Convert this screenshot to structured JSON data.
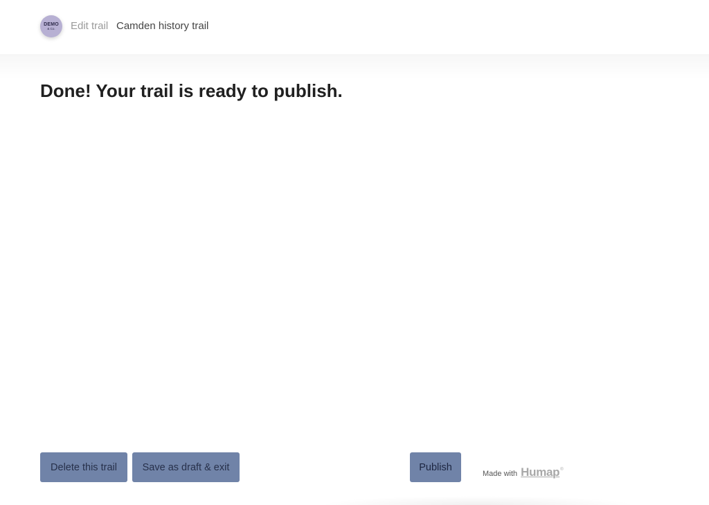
{
  "header": {
    "avatar": {
      "line1": "DEMO",
      "line2": "& Co."
    },
    "breadcrumb_edit": "Edit trail",
    "trail_title": "Camden history trail"
  },
  "main": {
    "heading": "Done! Your trail is ready to publish."
  },
  "footer": {
    "delete_label": "Delete this trail",
    "draft_label": "Save as draft & exit",
    "publish_label": "Publish",
    "made_with_label": "Made with",
    "brand": "Humap",
    "brand_mark": "®"
  },
  "colors": {
    "button_bg": "#7083a8",
    "avatar_bg": "#b7b0d3",
    "heading": "#202020"
  }
}
